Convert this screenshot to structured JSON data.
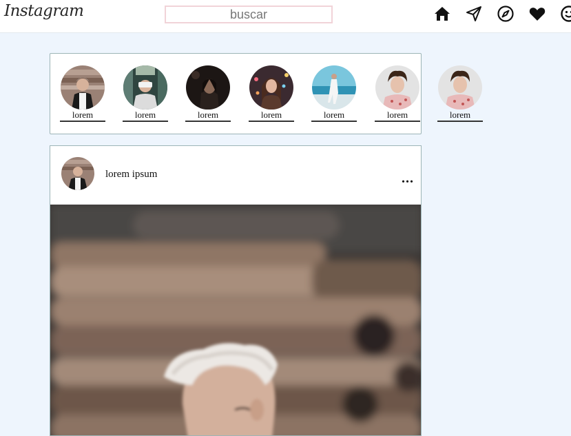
{
  "header": {
    "logo": "Instagram",
    "search_placeholder": "buscar",
    "icons": [
      "home-icon",
      "direct-send-icon",
      "explore-compass-icon",
      "heart-icon",
      "profile-smiley-icon"
    ]
  },
  "stories": [
    {
      "label": "lorem",
      "photo": "white-hair-man"
    },
    {
      "label": "lorem",
      "photo": "vr-headset"
    },
    {
      "label": "lorem",
      "photo": "woman-night"
    },
    {
      "label": "lorem",
      "photo": "woman-lights"
    },
    {
      "label": "lorem",
      "photo": "beach-runner"
    },
    {
      "label": "lorem",
      "photo": "curly-hair-person"
    },
    {
      "label": "lorem",
      "photo": "curly-hair-person"
    }
  ],
  "post": {
    "username": "lorem ipsum",
    "more_label": "...",
    "photo": "white-hair-man-logs"
  },
  "colors": {
    "page_bg": "#eef5fd",
    "card_border": "#9cb4b6"
  }
}
